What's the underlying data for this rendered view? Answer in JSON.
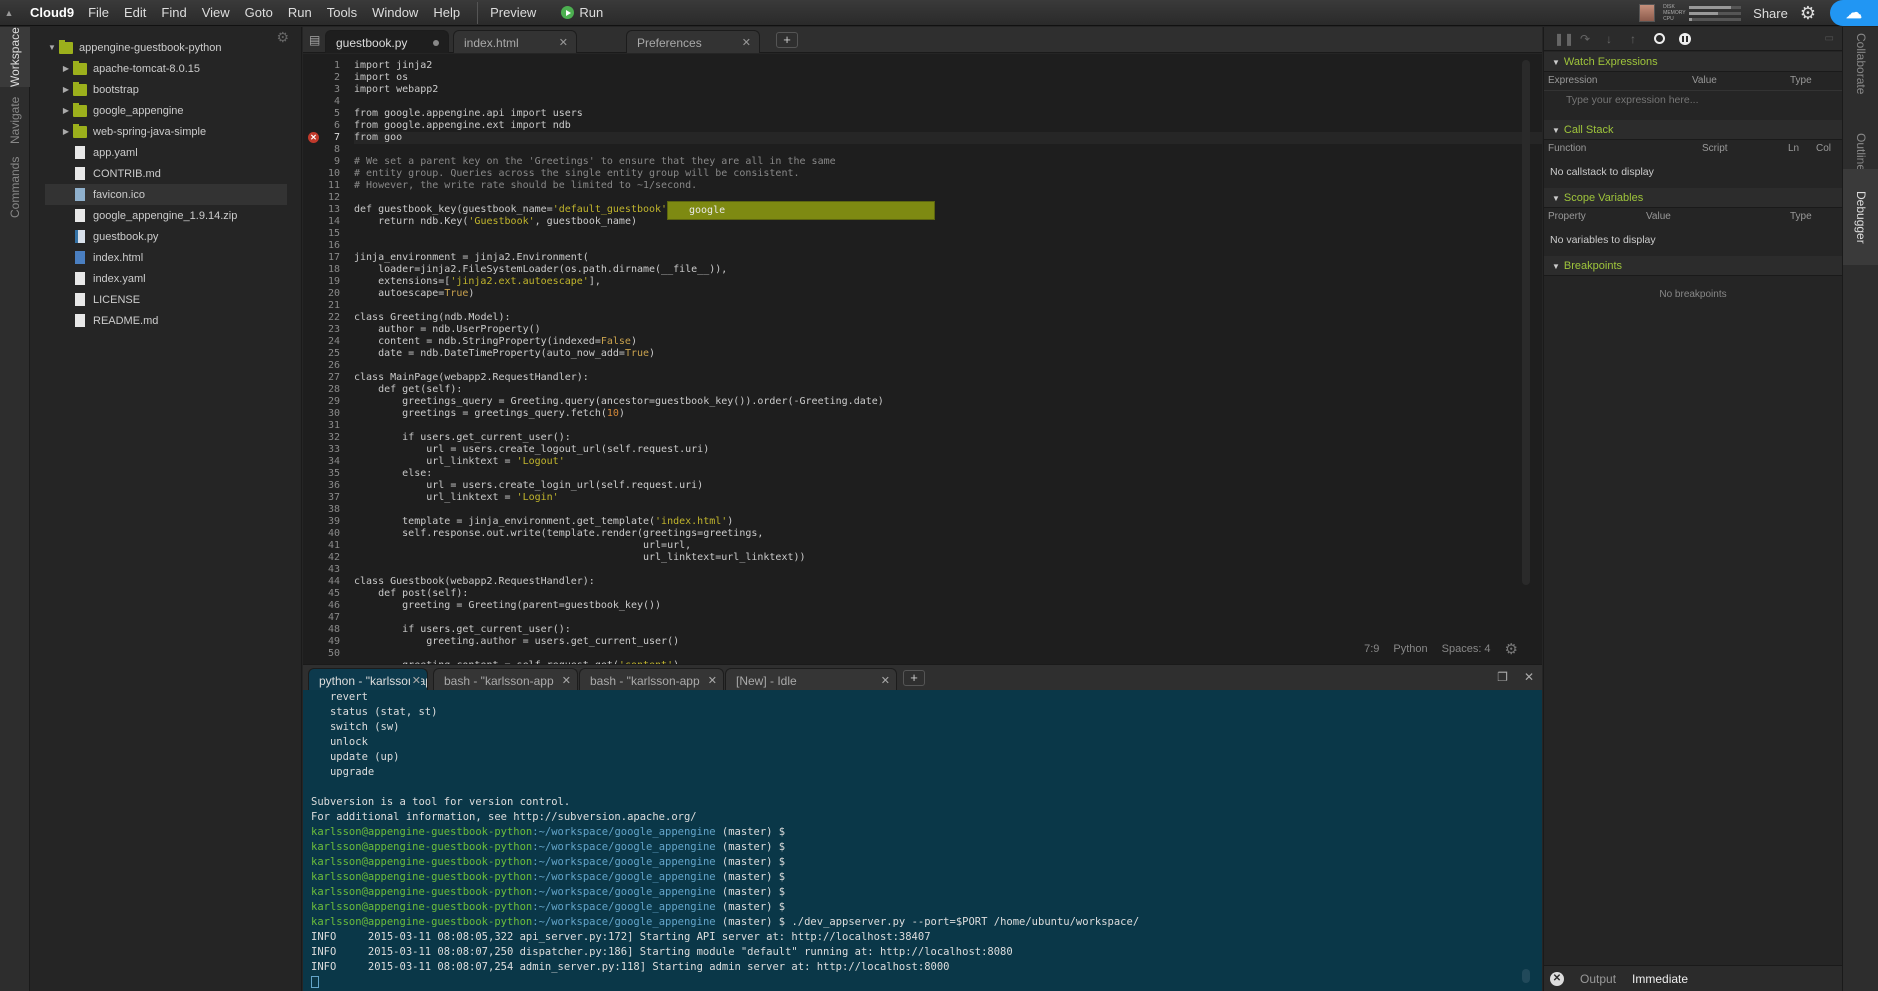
{
  "menubar": {
    "brand": "Cloud9",
    "menus": [
      "File",
      "Edit",
      "Find",
      "View",
      "Goto",
      "Run",
      "Tools",
      "Window",
      "Help"
    ],
    "preview_label": "Preview",
    "run_label": "Run",
    "meters": [
      {
        "label": "DISK",
        "level": 0.8
      },
      {
        "label": "MEMORY",
        "level": 0.55
      },
      {
        "label": "CPU",
        "level": 0.05
      }
    ],
    "share_label": "Share"
  },
  "leftbar": {
    "tabs": [
      "Workspace",
      "Navigate",
      "Commands"
    ]
  },
  "tree": {
    "root": "appengine-guestbook-python",
    "items": [
      {
        "label": "apache-tomcat-8.0.15",
        "kind": "folder"
      },
      {
        "label": "bootstrap",
        "kind": "folder"
      },
      {
        "label": "google_appengine",
        "kind": "folder"
      },
      {
        "label": "web-spring-java-simple",
        "kind": "folder"
      },
      {
        "label": "app.yaml",
        "kind": "file"
      },
      {
        "label": "CONTRIB.md",
        "kind": "file"
      },
      {
        "label": "favicon.ico",
        "kind": "img"
      },
      {
        "label": "google_appengine_1.9.14.zip",
        "kind": "file"
      },
      {
        "label": "guestbook.py",
        "kind": "py"
      },
      {
        "label": "index.html",
        "kind": "html"
      },
      {
        "label": "index.yaml",
        "kind": "file"
      },
      {
        "label": "LICENSE",
        "kind": "file"
      },
      {
        "label": "README.md",
        "kind": "file"
      }
    ]
  },
  "editor_tabs": [
    {
      "label": "guestbook.py",
      "active": true,
      "modified": true
    },
    {
      "label": "index.html",
      "active": false,
      "modified": false
    },
    {
      "label": "Preferences",
      "active": false,
      "modified": false
    }
  ],
  "editor": {
    "line_numbers": [
      "1",
      "2",
      "3",
      "4",
      "5",
      "6",
      "7",
      "8",
      "9",
      "10",
      "11",
      "12",
      "13",
      "14",
      "15",
      "16",
      "17",
      "18",
      "19",
      "20",
      "21",
      "22",
      "23",
      "24",
      "25",
      "26",
      "27",
      "28",
      "29",
      "30",
      "31",
      "32",
      "33",
      "34",
      "35",
      "36",
      "37",
      "38",
      "39",
      "40",
      "41",
      "42",
      "43",
      "44",
      "45",
      "46",
      "47",
      "48",
      "49",
      "50"
    ],
    "error_line": "7",
    "autocomplete": "google",
    "status": {
      "position": "7:9",
      "language": "Python",
      "indent": "Spaces: 4"
    }
  },
  "terminal_tabs": [
    {
      "label": "python - \"karlsson-ap",
      "active": true
    },
    {
      "label": "bash - \"karlsson-app",
      "active": false
    },
    {
      "label": "bash - \"karlsson-app",
      "active": false
    },
    {
      "label": "[New] - Idle",
      "active": false
    }
  ],
  "terminal": {
    "plain_lines": [
      "   revert",
      "   status (stat, st)",
      "   switch (sw)",
      "   unlock",
      "   update (up)",
      "   upgrade",
      "",
      "Subversion is a tool for version control.",
      "For additional information, see http://subversion.apache.org/"
    ],
    "prompt_user": "karlsson@appengine-guestbook-python",
    "prompt_path": ":~/workspace/google_appengine",
    "prompt_branch": " (master) $",
    "prompt_commands": [
      "",
      "",
      "",
      "",
      "",
      "",
      " ./dev_appserver.py --port=$PORT /home/ubuntu/workspace/"
    ],
    "log_lines": [
      "INFO     2015-03-11 08:08:05,322 api_server.py:172] Starting API server at: http://localhost:38407",
      "INFO     2015-03-11 08:08:07,250 dispatcher.py:186] Starting module \"default\" running at: http://localhost:8080",
      "INFO     2015-03-11 08:08:07,254 admin_server.py:118] Starting admin server at: http://localhost:8000"
    ]
  },
  "debugger": {
    "watch": {
      "title": "Watch Expressions",
      "cols": [
        "Expression",
        "Value",
        "Type"
      ],
      "placeholder": "Type your expression here..."
    },
    "callstack": {
      "title": "Call Stack",
      "cols": [
        "Function",
        "Script",
        "Ln",
        "Col"
      ],
      "empty": "No callstack to display"
    },
    "scope": {
      "title": "Scope Variables",
      "cols": [
        "Property",
        "Value",
        "Type"
      ],
      "empty": "No variables to display"
    },
    "breakpoints": {
      "title": "Breakpoints",
      "empty": "No breakpoints"
    },
    "bottom_tabs": [
      "Output",
      "Immediate"
    ]
  },
  "rightbar": {
    "tabs": [
      "Collaborate",
      "Outline",
      "Debugger"
    ]
  }
}
